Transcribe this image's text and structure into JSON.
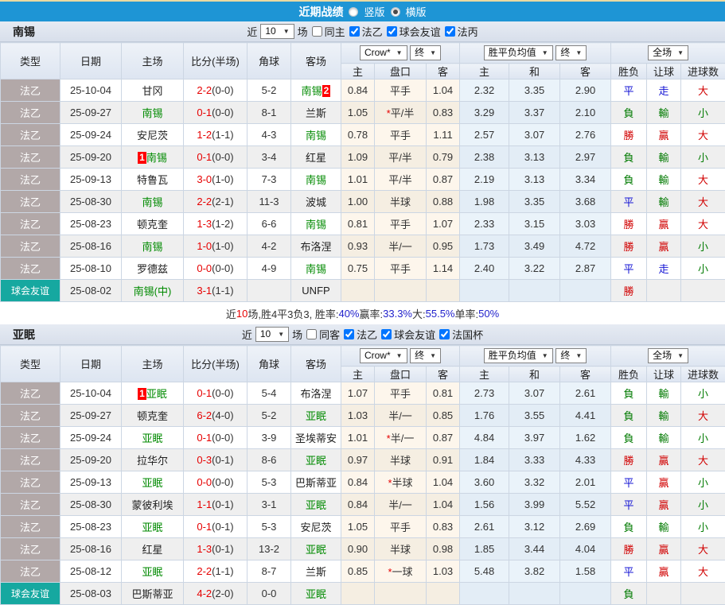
{
  "titlebar": {
    "title": "近期战绩",
    "radios": [
      {
        "label": "竖版",
        "selected": false
      },
      {
        "label": "横版",
        "selected": true
      }
    ]
  },
  "table_header": {
    "static_cols": [
      "类型",
      "日期",
      "主场",
      "比分(半场)",
      "角球",
      "客场"
    ],
    "group1": {
      "dd1": "Crow*",
      "dd2": "终",
      "cols": [
        "主",
        "盘口",
        "客"
      ]
    },
    "group2": {
      "dd1": "胜平负均值",
      "dd2": "终",
      "cols": [
        "主",
        "和",
        "客"
      ]
    },
    "group3": {
      "dd1": "全场",
      "cols": [
        "胜负",
        "让球",
        "进球数"
      ]
    }
  },
  "sections": [
    {
      "team": "南锡",
      "filter": {
        "prefix": "近",
        "count": "10",
        "suffix": "场",
        "uncheck_label": "同主",
        "checked_labels": [
          "法乙",
          "球会友谊",
          "法丙"
        ]
      },
      "rows": [
        {
          "type": "法乙",
          "friendly": false,
          "date": "25-10-04",
          "home": {
            "name": "甘冈",
            "green": false
          },
          "score": "2-2",
          "half": "(0-0)",
          "corner": "5-2",
          "away": {
            "name": "南锡",
            "green": true,
            "badge": "2",
            "badgePos": "after"
          },
          "ahHome": "0.84",
          "handicap": "平手",
          "handicapStar": false,
          "ahAway": "1.04",
          "euHome": "2.32",
          "euDraw": "3.35",
          "euAway": "2.90",
          "resWdl": {
            "text": "平",
            "color": "blue"
          },
          "resAh": {
            "text": "走",
            "color": "blue"
          },
          "resOu": {
            "text": "大",
            "color": "red"
          }
        },
        {
          "type": "法乙",
          "friendly": false,
          "date": "25-09-27",
          "home": {
            "name": "南锡",
            "green": true
          },
          "score": "0-1",
          "half": "(0-0)",
          "corner": "8-1",
          "away": {
            "name": "兰斯",
            "green": false
          },
          "ahHome": "1.05",
          "handicap": "平/半",
          "handicapStar": true,
          "ahAway": "0.83",
          "euHome": "3.29",
          "euDraw": "3.37",
          "euAway": "2.10",
          "resWdl": {
            "text": "負",
            "color": "green"
          },
          "resAh": {
            "text": "輸",
            "color": "green"
          },
          "resOu": {
            "text": "小",
            "color": "green"
          }
        },
        {
          "type": "法乙",
          "friendly": false,
          "date": "25-09-24",
          "home": {
            "name": "安尼茨",
            "green": false
          },
          "score": "1-2",
          "half": "(1-1)",
          "corner": "4-3",
          "away": {
            "name": "南锡",
            "green": true
          },
          "ahHome": "0.78",
          "handicap": "平手",
          "handicapStar": false,
          "ahAway": "1.11",
          "euHome": "2.57",
          "euDraw": "3.07",
          "euAway": "2.76",
          "resWdl": {
            "text": "勝",
            "color": "red"
          },
          "resAh": {
            "text": "贏",
            "color": "red"
          },
          "resOu": {
            "text": "大",
            "color": "red"
          }
        },
        {
          "type": "法乙",
          "friendly": false,
          "date": "25-09-20",
          "home": {
            "name": "南锡",
            "green": true,
            "badge": "1",
            "badgePos": "before"
          },
          "score": "0-1",
          "half": "(0-0)",
          "corner": "3-4",
          "away": {
            "name": "红星",
            "green": false
          },
          "ahHome": "1.09",
          "handicap": "平/半",
          "handicapStar": false,
          "ahAway": "0.79",
          "euHome": "2.38",
          "euDraw": "3.13",
          "euAway": "2.97",
          "resWdl": {
            "text": "負",
            "color": "green"
          },
          "resAh": {
            "text": "輸",
            "color": "green"
          },
          "resOu": {
            "text": "小",
            "color": "green"
          }
        },
        {
          "type": "法乙",
          "friendly": false,
          "date": "25-09-13",
          "home": {
            "name": "特鲁瓦",
            "green": false
          },
          "score": "3-0",
          "half": "(1-0)",
          "corner": "7-3",
          "away": {
            "name": "南锡",
            "green": true
          },
          "ahHome": "1.01",
          "handicap": "平/半",
          "handicapStar": false,
          "ahAway": "0.87",
          "euHome": "2.19",
          "euDraw": "3.13",
          "euAway": "3.34",
          "resWdl": {
            "text": "負",
            "color": "green"
          },
          "resAh": {
            "text": "輸",
            "color": "green"
          },
          "resOu": {
            "text": "大",
            "color": "red"
          }
        },
        {
          "type": "法乙",
          "friendly": false,
          "date": "25-08-30",
          "home": {
            "name": "南锡",
            "green": true
          },
          "score": "2-2",
          "half": "(2-1)",
          "corner": "11-3",
          "away": {
            "name": "波城",
            "green": false
          },
          "ahHome": "1.00",
          "handicap": "半球",
          "handicapStar": false,
          "ahAway": "0.88",
          "euHome": "1.98",
          "euDraw": "3.35",
          "euAway": "3.68",
          "resWdl": {
            "text": "平",
            "color": "blue"
          },
          "resAh": {
            "text": "輸",
            "color": "green"
          },
          "resOu": {
            "text": "大",
            "color": "red"
          }
        },
        {
          "type": "法乙",
          "friendly": false,
          "date": "25-08-23",
          "home": {
            "name": "顿克奎",
            "green": false
          },
          "score": "1-3",
          "half": "(1-2)",
          "corner": "6-6",
          "away": {
            "name": "南锡",
            "green": true
          },
          "ahHome": "0.81",
          "handicap": "平手",
          "handicapStar": false,
          "ahAway": "1.07",
          "euHome": "2.33",
          "euDraw": "3.15",
          "euAway": "3.03",
          "resWdl": {
            "text": "勝",
            "color": "red"
          },
          "resAh": {
            "text": "贏",
            "color": "red"
          },
          "resOu": {
            "text": "大",
            "color": "red"
          }
        },
        {
          "type": "法乙",
          "friendly": false,
          "date": "25-08-16",
          "home": {
            "name": "南锡",
            "green": true
          },
          "score": "1-0",
          "half": "(1-0)",
          "corner": "4-2",
          "away": {
            "name": "布洛涅",
            "green": false
          },
          "ahHome": "0.93",
          "handicap": "半/一",
          "handicapStar": false,
          "ahAway": "0.95",
          "euHome": "1.73",
          "euDraw": "3.49",
          "euAway": "4.72",
          "resWdl": {
            "text": "勝",
            "color": "red"
          },
          "resAh": {
            "text": "贏",
            "color": "red"
          },
          "resOu": {
            "text": "小",
            "color": "green"
          }
        },
        {
          "type": "法乙",
          "friendly": false,
          "date": "25-08-10",
          "home": {
            "name": "罗德兹",
            "green": false
          },
          "score": "0-0",
          "half": "(0-0)",
          "corner": "4-9",
          "away": {
            "name": "南锡",
            "green": true
          },
          "ahHome": "0.75",
          "handicap": "平手",
          "handicapStar": false,
          "ahAway": "1.14",
          "euHome": "2.40",
          "euDraw": "3.22",
          "euAway": "2.87",
          "resWdl": {
            "text": "平",
            "color": "blue"
          },
          "resAh": {
            "text": "走",
            "color": "blue"
          },
          "resOu": {
            "text": "小",
            "color": "green"
          }
        },
        {
          "type": "球会友谊",
          "friendly": true,
          "date": "25-08-02",
          "home": {
            "name": "南锡(中)",
            "green": true
          },
          "score": "3-1",
          "half": "(1-1)",
          "corner": "",
          "away": {
            "name": "UNFP",
            "green": false
          },
          "ahHome": "",
          "handicap": "",
          "handicapStar": false,
          "ahAway": "",
          "euHome": "",
          "euDraw": "",
          "euAway": "",
          "resWdl": {
            "text": "勝",
            "color": "red"
          },
          "resAh": {
            "text": "",
            "color": ""
          },
          "resOu": {
            "text": "",
            "color": ""
          }
        }
      ],
      "summary": [
        {
          "t": "近",
          "c": "k"
        },
        {
          "t": "10",
          "c": "r"
        },
        {
          "t": "场,胜4平3负3, 胜率:",
          "c": "k"
        },
        {
          "t": "40%",
          "c": "b"
        },
        {
          "t": " 赢率:",
          "c": "k"
        },
        {
          "t": "33.3%",
          "c": "b"
        },
        {
          "t": " 大:",
          "c": "k"
        },
        {
          "t": "55.5%",
          "c": "b"
        },
        {
          "t": " 单率:",
          "c": "k"
        },
        {
          "t": "50%",
          "c": "b"
        }
      ]
    },
    {
      "team": "亚眠",
      "filter": {
        "prefix": "近",
        "count": "10",
        "suffix": "场",
        "uncheck_label": "同客",
        "checked_labels": [
          "法乙",
          "球会友谊",
          "法国杯"
        ]
      },
      "rows": [
        {
          "type": "法乙",
          "friendly": false,
          "date": "25-10-04",
          "home": {
            "name": "亚眠",
            "green": true,
            "badge": "1",
            "badgePos": "before"
          },
          "score": "0-1",
          "half": "(0-0)",
          "corner": "5-4",
          "away": {
            "name": "布洛涅",
            "green": false
          },
          "ahHome": "1.07",
          "handicap": "平手",
          "handicapStar": false,
          "ahAway": "0.81",
          "euHome": "2.73",
          "euDraw": "3.07",
          "euAway": "2.61",
          "resWdl": {
            "text": "負",
            "color": "green"
          },
          "resAh": {
            "text": "輸",
            "color": "green"
          },
          "resOu": {
            "text": "小",
            "color": "green"
          }
        },
        {
          "type": "法乙",
          "friendly": false,
          "date": "25-09-27",
          "home": {
            "name": "顿克奎",
            "green": false
          },
          "score": "6-2",
          "half": "(4-0)",
          "corner": "5-2",
          "away": {
            "name": "亚眠",
            "green": true
          },
          "ahHome": "1.03",
          "handicap": "半/一",
          "handicapStar": false,
          "ahAway": "0.85",
          "euHome": "1.76",
          "euDraw": "3.55",
          "euAway": "4.41",
          "resWdl": {
            "text": "負",
            "color": "green"
          },
          "resAh": {
            "text": "輸",
            "color": "green"
          },
          "resOu": {
            "text": "大",
            "color": "red"
          }
        },
        {
          "type": "法乙",
          "friendly": false,
          "date": "25-09-24",
          "home": {
            "name": "亚眠",
            "green": true
          },
          "score": "0-1",
          "half": "(0-0)",
          "corner": "3-9",
          "away": {
            "name": "圣埃蒂安",
            "green": false
          },
          "ahHome": "1.01",
          "handicap": "半/一",
          "handicapStar": true,
          "ahAway": "0.87",
          "euHome": "4.84",
          "euDraw": "3.97",
          "euAway": "1.62",
          "resWdl": {
            "text": "負",
            "color": "green"
          },
          "resAh": {
            "text": "輸",
            "color": "green"
          },
          "resOu": {
            "text": "小",
            "color": "green"
          }
        },
        {
          "type": "法乙",
          "friendly": false,
          "date": "25-09-20",
          "home": {
            "name": "拉华尔",
            "green": false
          },
          "score": "0-3",
          "half": "(0-1)",
          "corner": "8-6",
          "away": {
            "name": "亚眠",
            "green": true
          },
          "ahHome": "0.97",
          "handicap": "半球",
          "handicapStar": false,
          "ahAway": "0.91",
          "euHome": "1.84",
          "euDraw": "3.33",
          "euAway": "4.33",
          "resWdl": {
            "text": "勝",
            "color": "red"
          },
          "resAh": {
            "text": "贏",
            "color": "red"
          },
          "resOu": {
            "text": "大",
            "color": "red"
          }
        },
        {
          "type": "法乙",
          "friendly": false,
          "date": "25-09-13",
          "home": {
            "name": "亚眠",
            "green": true
          },
          "score": "0-0",
          "half": "(0-0)",
          "corner": "5-3",
          "away": {
            "name": "巴斯蒂亚",
            "green": false
          },
          "ahHome": "0.84",
          "handicap": "半球",
          "handicapStar": true,
          "ahAway": "1.04",
          "euHome": "3.60",
          "euDraw": "3.32",
          "euAway": "2.01",
          "resWdl": {
            "text": "平",
            "color": "blue"
          },
          "resAh": {
            "text": "贏",
            "color": "red"
          },
          "resOu": {
            "text": "小",
            "color": "green"
          }
        },
        {
          "type": "法乙",
          "friendly": false,
          "date": "25-08-30",
          "home": {
            "name": "蒙彼利埃",
            "green": false
          },
          "score": "1-1",
          "half": "(0-1)",
          "corner": "3-1",
          "away": {
            "name": "亚眠",
            "green": true
          },
          "ahHome": "0.84",
          "handicap": "半/一",
          "handicapStar": false,
          "ahAway": "1.04",
          "euHome": "1.56",
          "euDraw": "3.99",
          "euAway": "5.52",
          "resWdl": {
            "text": "平",
            "color": "blue"
          },
          "resAh": {
            "text": "贏",
            "color": "red"
          },
          "resOu": {
            "text": "小",
            "color": "green"
          }
        },
        {
          "type": "法乙",
          "friendly": false,
          "date": "25-08-23",
          "home": {
            "name": "亚眠",
            "green": true
          },
          "score": "0-1",
          "half": "(0-1)",
          "corner": "5-3",
          "away": {
            "name": "安尼茨",
            "green": false
          },
          "ahHome": "1.05",
          "handicap": "平手",
          "handicapStar": false,
          "ahAway": "0.83",
          "euHome": "2.61",
          "euDraw": "3.12",
          "euAway": "2.69",
          "resWdl": {
            "text": "負",
            "color": "green"
          },
          "resAh": {
            "text": "輸",
            "color": "green"
          },
          "resOu": {
            "text": "小",
            "color": "green"
          }
        },
        {
          "type": "法乙",
          "friendly": false,
          "date": "25-08-16",
          "home": {
            "name": "红星",
            "green": false
          },
          "score": "1-3",
          "half": "(0-1)",
          "corner": "13-2",
          "away": {
            "name": "亚眠",
            "green": true
          },
          "ahHome": "0.90",
          "handicap": "半球",
          "handicapStar": false,
          "ahAway": "0.98",
          "euHome": "1.85",
          "euDraw": "3.44",
          "euAway": "4.04",
          "resWdl": {
            "text": "勝",
            "color": "red"
          },
          "resAh": {
            "text": "贏",
            "color": "red"
          },
          "resOu": {
            "text": "大",
            "color": "red"
          }
        },
        {
          "type": "法乙",
          "friendly": false,
          "date": "25-08-12",
          "home": {
            "name": "亚眠",
            "green": true
          },
          "score": "2-2",
          "half": "(1-1)",
          "corner": "8-7",
          "away": {
            "name": "兰斯",
            "green": false
          },
          "ahHome": "0.85",
          "handicap": "一球",
          "handicapStar": true,
          "ahAway": "1.03",
          "euHome": "5.48",
          "euDraw": "3.82",
          "euAway": "1.58",
          "resWdl": {
            "text": "平",
            "color": "blue"
          },
          "resAh": {
            "text": "贏",
            "color": "red"
          },
          "resOu": {
            "text": "大",
            "color": "red"
          }
        },
        {
          "type": "球会友谊",
          "friendly": true,
          "date": "25-08-03",
          "home": {
            "name": "巴斯蒂亚",
            "green": false
          },
          "score": "4-2",
          "half": "(2-0)",
          "corner": "0-0",
          "away": {
            "name": "亚眠",
            "green": true
          },
          "ahHome": "",
          "handicap": "",
          "handicapStar": false,
          "ahAway": "",
          "euHome": "",
          "euDraw": "",
          "euAway": "",
          "resWdl": {
            "text": "負",
            "color": "green"
          },
          "resAh": {
            "text": "",
            "color": ""
          },
          "resOu": {
            "text": "",
            "color": ""
          }
        }
      ],
      "summary": null
    }
  ]
}
